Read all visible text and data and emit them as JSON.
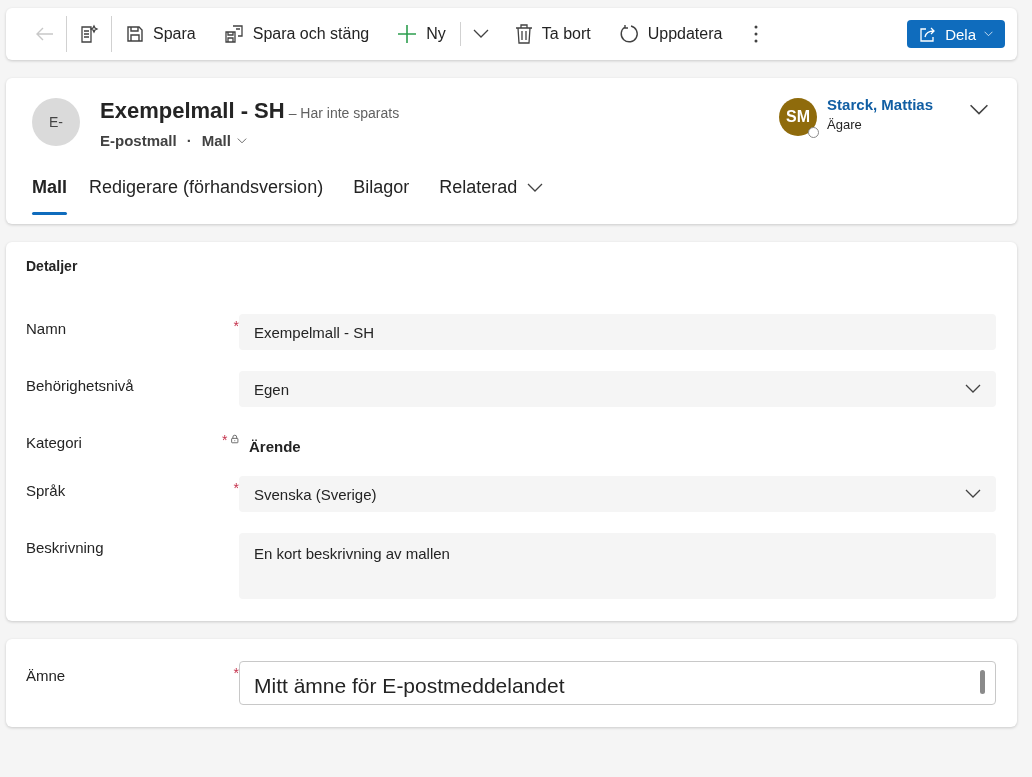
{
  "toolbar": {
    "back_disabled": true,
    "items": [
      {
        "label": "Spara"
      },
      {
        "label": "Spara och stäng"
      },
      {
        "label": "Ny"
      },
      {
        "label": "Ta bort"
      },
      {
        "label": "Uppdatera"
      }
    ],
    "share": {
      "label": "Dela"
    }
  },
  "header": {
    "avatar": "E-",
    "title": "Exempelmall - SH",
    "save_status": "– Har inte sparats",
    "entity": "E-postmall",
    "separator": "·",
    "form": "Mall",
    "owner": {
      "initials": "SM",
      "name": "Starck, Mattias",
      "role": "Ägare"
    },
    "tabs": [
      {
        "label": "Mall",
        "selected": true,
        "kind": "tab"
      },
      {
        "label": "Redigerare (förhandsversion)",
        "selected": false,
        "kind": "tab"
      },
      {
        "label": "Bilagor",
        "selected": false,
        "kind": "tab"
      },
      {
        "label": "Relaterad",
        "selected": false,
        "kind": "menu"
      }
    ]
  },
  "details": {
    "title": "Detaljer",
    "fields": [
      {
        "label": "Namn",
        "required_mark": "*",
        "locked": false,
        "kind": "text",
        "value": "Exempelmall - SH"
      },
      {
        "label": "Behörighetsnivå",
        "locked": false,
        "kind": "select",
        "value": "Egen"
      },
      {
        "label": "Kategori",
        "required_mark": "*",
        "locked": true,
        "kind": "readonly",
        "value": "Ärende"
      },
      {
        "label": "Språk",
        "required_mark": "*",
        "locked": false,
        "kind": "select",
        "value": "Svenska (Sverige)"
      },
      {
        "label": "Beskrivning",
        "locked": false,
        "kind": "textarea",
        "value": "En kort beskrivning av mallen"
      }
    ]
  },
  "subject": {
    "fields": [
      {
        "label": "Ämne",
        "required_mark": "*",
        "locked": false,
        "kind": "subject",
        "value": "Mitt ämne för E-postmeddelandet"
      }
    ]
  }
}
